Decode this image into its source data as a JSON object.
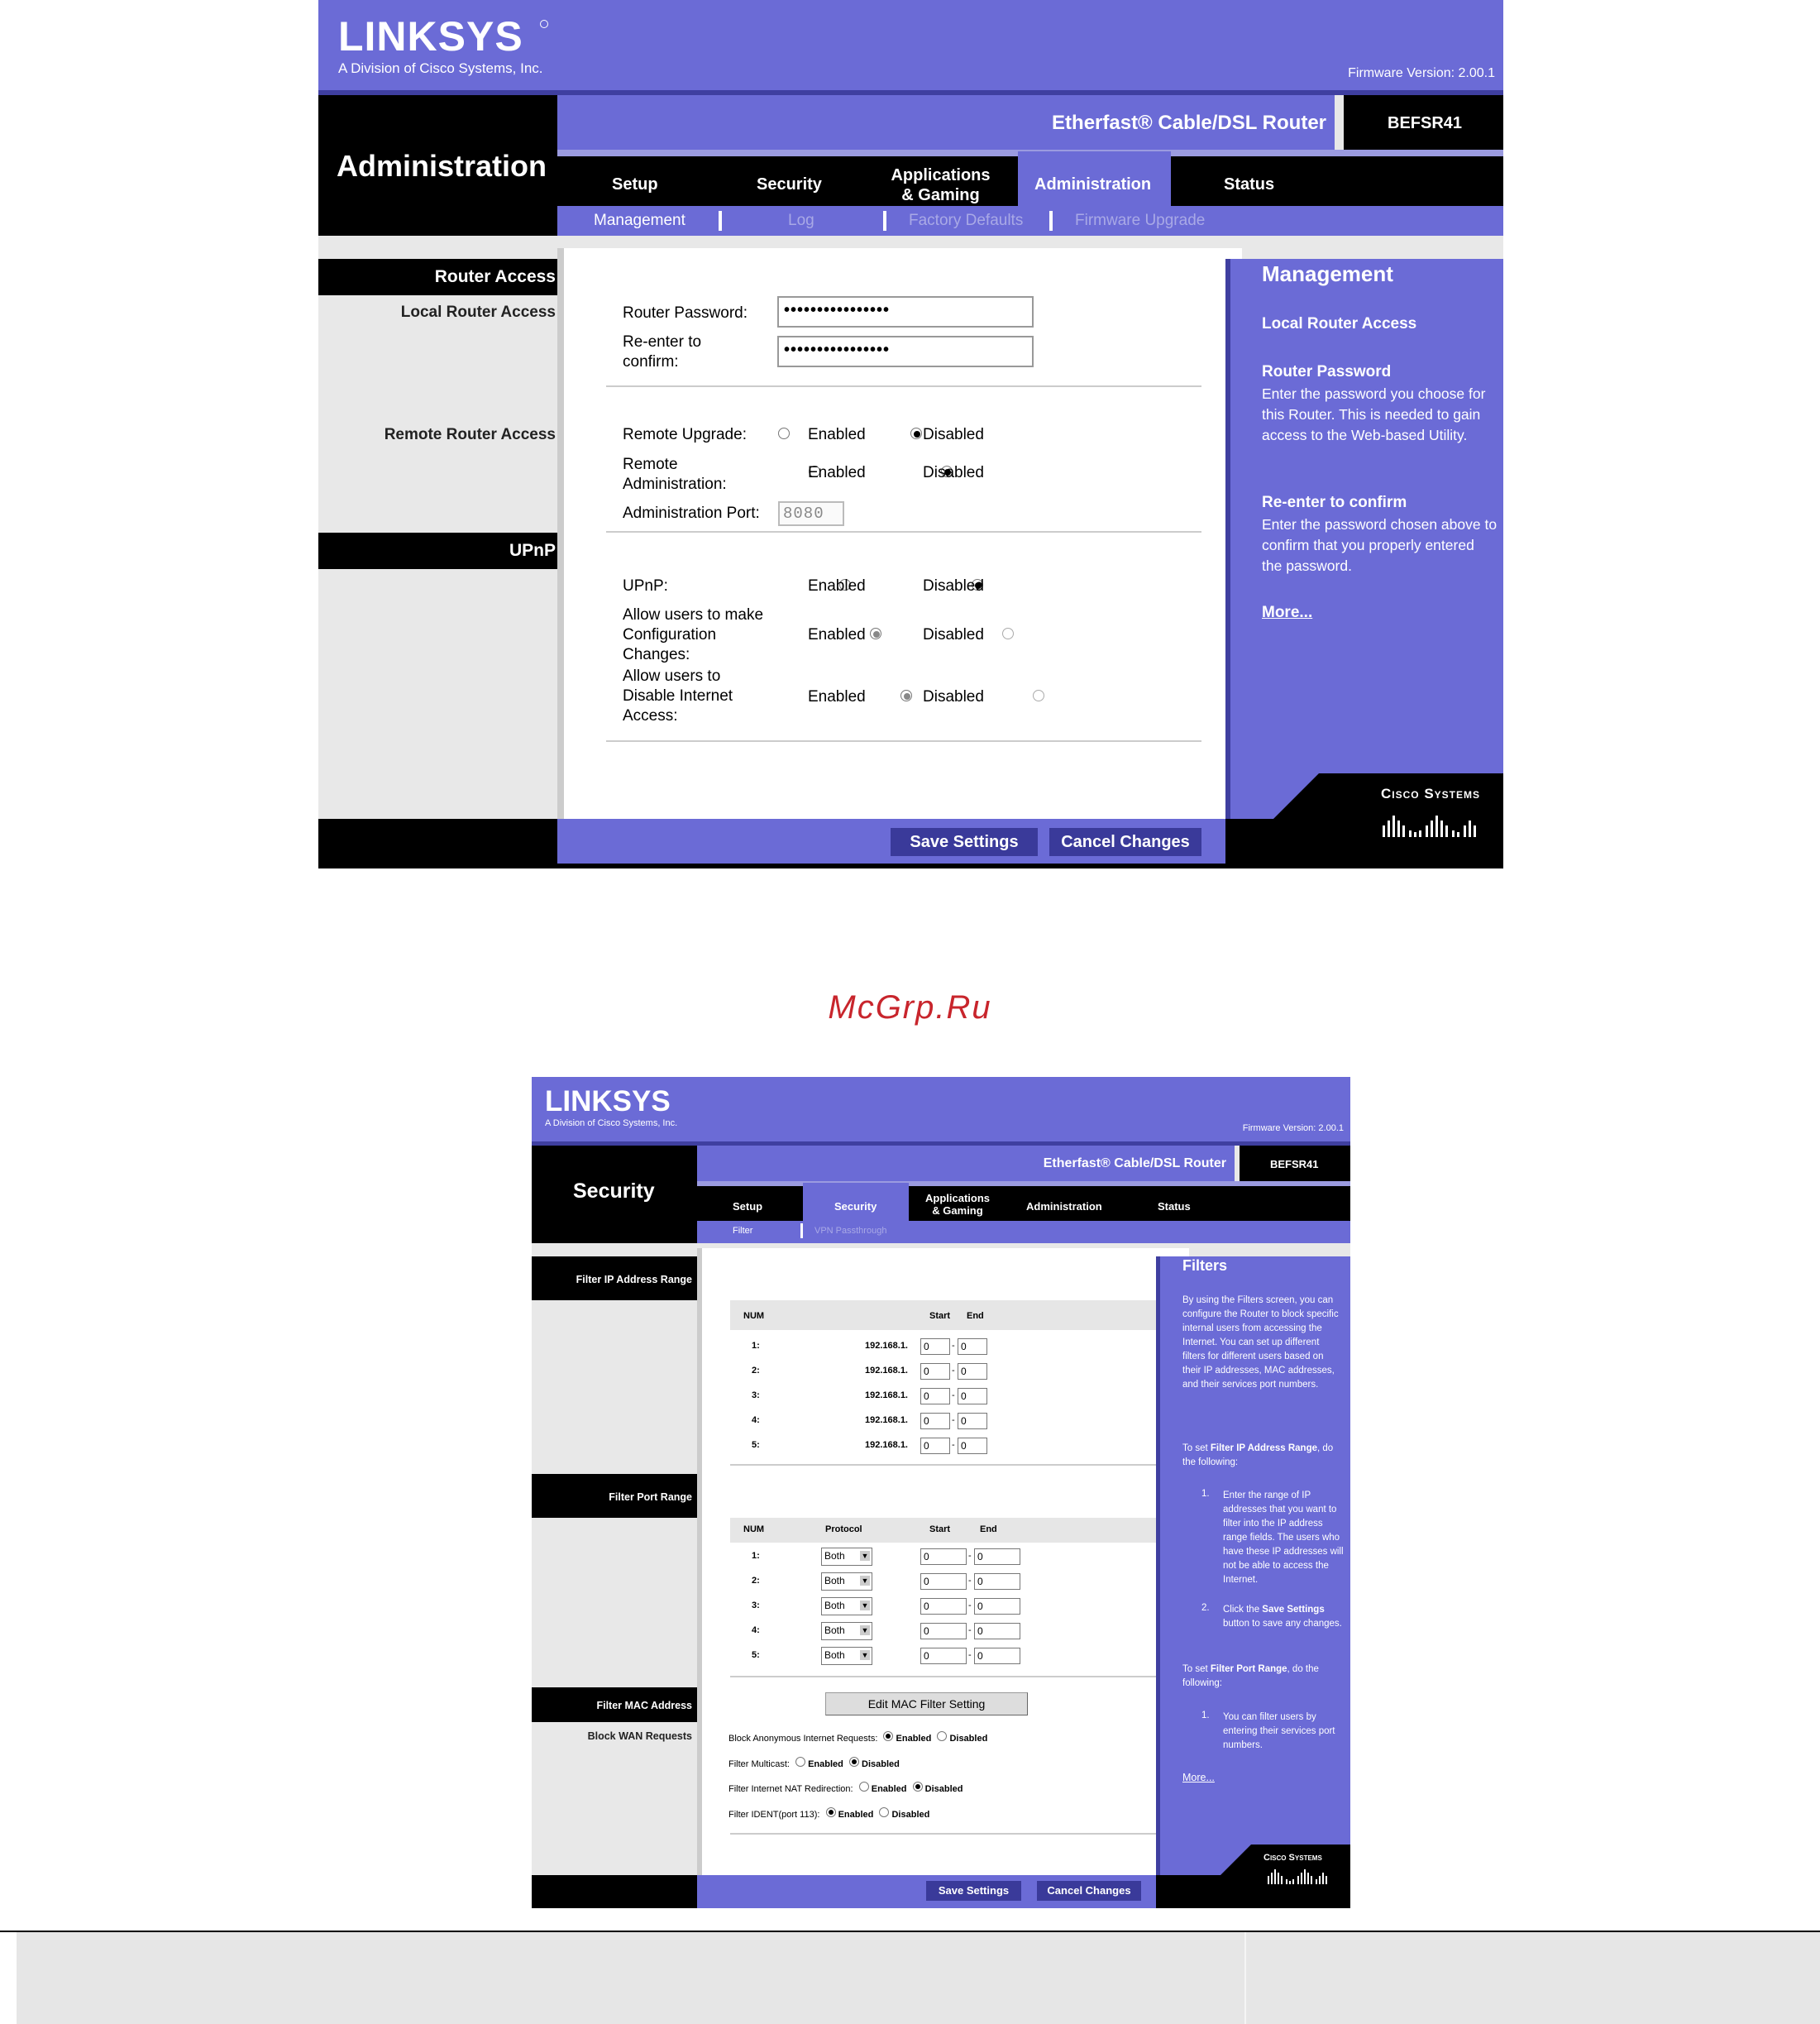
{
  "top": {
    "brand": "LINKSYS",
    "brand_sub": "A Division of Cisco Systems, Inc.",
    "firmware": "Firmware Version: 2.00.1",
    "product": "Etherfast® Cable/DSL Router",
    "model": "BEFSR41",
    "section_title": "Administration",
    "tabs": [
      "Setup",
      "Security",
      "Applications\n& Gaming",
      "Administration",
      "Status"
    ],
    "subtabs": [
      "Management",
      "Log",
      "Factory Defaults",
      "Firmware Upgrade"
    ],
    "side": {
      "router_access": "Router Access",
      "local_router_access": "Local Router Access",
      "remote_router_access": "Remote Router Access",
      "upnp": "UPnP"
    },
    "form": {
      "router_password_label": "Router Password:",
      "router_password_value": "••••••••••••••••",
      "reenter_label": "Re-enter to confirm:",
      "reenter_value": "••••••••••••••••",
      "remote_upgrade_label": "Remote Upgrade:",
      "remote_admin_label": "Remote Administration:",
      "admin_port_label": "Administration Port:",
      "admin_port_value": "8080",
      "upnp_label": "UPnP:",
      "allow_config_label": "Allow users to make Configuration Changes:",
      "allow_disable_label": "Allow users to Disable Internet Access:",
      "enabled": "Enabled",
      "disabled": "Disabled"
    },
    "help": {
      "title": "Management",
      "h1": "Local Router Access",
      "h2": "Router Password",
      "p2": "Enter the password you choose for this Router. This is needed to gain access to the Web-based Utility.",
      "h3": "Re-enter to confirm",
      "p3": "Enter the password chosen above to confirm that you properly entered the password.",
      "more": "More..."
    },
    "cisco": "Cisco Systems",
    "save": "Save Settings",
    "cancel": "Cancel Changes"
  },
  "watermark": "McGrp.Ru",
  "bottom": {
    "brand": "LINKSYS",
    "brand_sub": "A Division of Cisco Systems, Inc.",
    "firmware": "Firmware Version: 2.00.1",
    "product": "Etherfast® Cable/DSL Router",
    "model": "BEFSR41",
    "section_title": "Security",
    "tabs": [
      "Setup",
      "Security",
      "Applications\n& Gaming",
      "Administration",
      "Status"
    ],
    "subtabs": [
      "Filter",
      "VPN Passthrough"
    ],
    "side": {
      "filter_ip": "Filter IP Address Range",
      "filter_port": "Filter Port Range",
      "filter_mac": "Filter MAC Address",
      "block_wan": "Block WAN Requests"
    },
    "ip_table": {
      "num": "NUM",
      "start": "Start",
      "end": "End",
      "rows": [
        {
          "n": "1:",
          "prefix": "192.168.1.",
          "start": "0",
          "end": "0"
        },
        {
          "n": "2:",
          "prefix": "192.168.1.",
          "start": "0",
          "end": "0"
        },
        {
          "n": "3:",
          "prefix": "192.168.1.",
          "start": "0",
          "end": "0"
        },
        {
          "n": "4:",
          "prefix": "192.168.1.",
          "start": "0",
          "end": "0"
        },
        {
          "n": "5:",
          "prefix": "192.168.1.",
          "start": "0",
          "end": "0"
        }
      ]
    },
    "port_table": {
      "num": "NUM",
      "protocol": "Protocol",
      "start": "Start",
      "end": "End",
      "rows": [
        {
          "n": "1:",
          "protocol": "Both",
          "start": "0",
          "end": "0"
        },
        {
          "n": "2:",
          "protocol": "Both",
          "start": "0",
          "end": "0"
        },
        {
          "n": "3:",
          "protocol": "Both",
          "start": "0",
          "end": "0"
        },
        {
          "n": "4:",
          "protocol": "Both",
          "start": "0",
          "end": "0"
        },
        {
          "n": "5:",
          "protocol": "Both",
          "start": "0",
          "end": "0"
        }
      ]
    },
    "edit_mac": "Edit MAC Filter Setting",
    "wan": {
      "block_anon": "Block Anonymous Internet Requests:",
      "multicast": "Filter Multicast:",
      "nat": "Filter Internet NAT Redirection:",
      "ident": "Filter IDENT(port 113):",
      "enabled": "Enabled",
      "disabled": "Disabled"
    },
    "help": {
      "title": "Filters",
      "p1": "By using the Filters screen, you can configure the Router to block specific internal users from accessing the Internet. You can set up different filters for different users based on their IP addresses, MAC addresses, and their services port numbers.",
      "p2a": "To set ",
      "p2b": "Filter IP Address Range",
      "p2c": ", do the following:",
      "li1": "Enter the range of IP addresses that you want to filter into the IP address range fields. The users who have these IP addresses will not be able to access the Internet.",
      "li2a": "Click the ",
      "li2b": "Save Settings",
      "li2c": " button to save any changes.",
      "p3a": "To set ",
      "p3b": "Filter Port Range",
      "p3c": ", do the following:",
      "li3": "You can filter users by entering their services port numbers.",
      "more": "More..."
    },
    "cisco": "Cisco Systems",
    "save": "Save Settings",
    "cancel": "Cancel Changes"
  }
}
